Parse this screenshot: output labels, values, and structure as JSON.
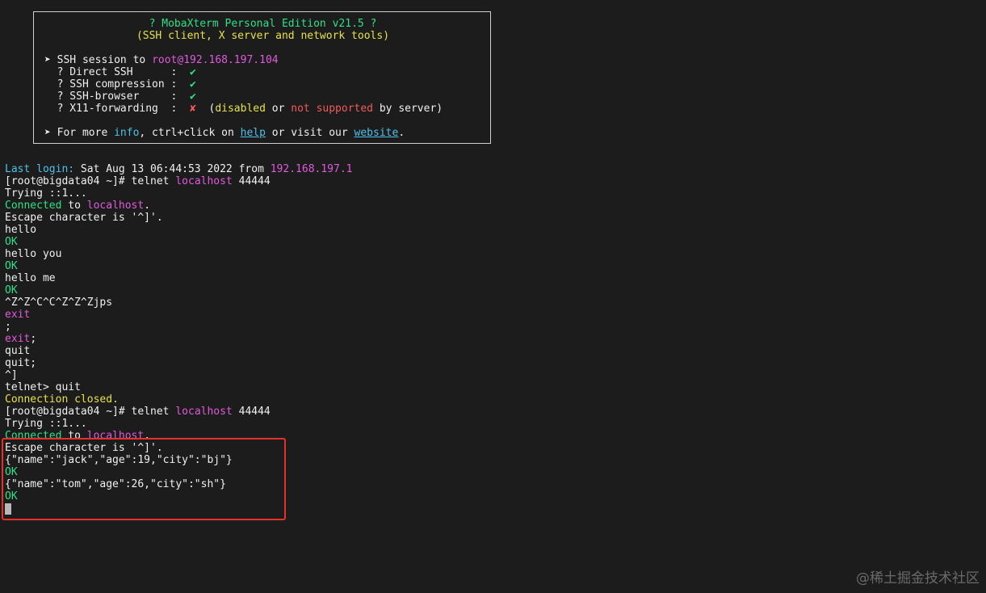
{
  "banner": {
    "title": "? MobaXterm Personal Edition v21.5 ?",
    "subtitle": "(SSH client, X server and network tools)",
    "session_prefix": "➤ SSH session to ",
    "session_target": "root@192.168.197.104",
    "features": [
      {
        "label": "  ? Direct SSH      :  ",
        "mark": "✔"
      },
      {
        "label": "  ? SSH compression :  ",
        "mark": "✔"
      },
      {
        "label": "  ? SSH-browser     :  ",
        "mark": "✔"
      },
      {
        "label": "  ? X11-forwarding  :  ",
        "mark": "✘"
      }
    ],
    "x11_note": {
      "open": "  (",
      "disabled": "disabled",
      "or": " or ",
      "not_supported": "not supported",
      "by_server": " by server)"
    },
    "more": {
      "prefix": "➤ For more ",
      "info": "info",
      "mid1": ", ctrl+click on ",
      "help": "help",
      "mid2": " or visit our ",
      "website": "website",
      "suffix": "."
    }
  },
  "terminal": {
    "last_login_label": "Last login:",
    "last_login_date": " Sat Aug 13 06:44:53 2022 from ",
    "last_login_ip": "192.168.197.1",
    "prompt": "[root@bigdata04 ~]# ",
    "cmd_telnet": "telnet ",
    "cmd_host": "localhost",
    "cmd_port": " 44444",
    "trying": "Trying ::1...",
    "connected": "Connected",
    "to": " to ",
    "connected_host": "localhost",
    "period": ".",
    "escape": "Escape character is '^]'.",
    "hello": "hello",
    "ok": "OK",
    "hello_you": "hello you",
    "hello_me": "hello me",
    "ctrl_seq": "^Z^Z^C^C^Z^Z^Zjps",
    "exit": "exit",
    "semicolon": ";",
    "exit_semi_word": "exit",
    "exit_semi_tail": ";",
    "quit": "quit",
    "quit_semi": "quit;",
    "caret_bracket": "^]",
    "telnet_quit": "telnet> quit",
    "conn_closed": "Connection closed.",
    "json1": "{\"name\":\"jack\",\"age\":19,\"city\":\"bj\"}",
    "json2": "{\"name\":\"tom\",\"age\":26,\"city\":\"sh\"}"
  },
  "watermark": "@稀土掘金技术社区"
}
